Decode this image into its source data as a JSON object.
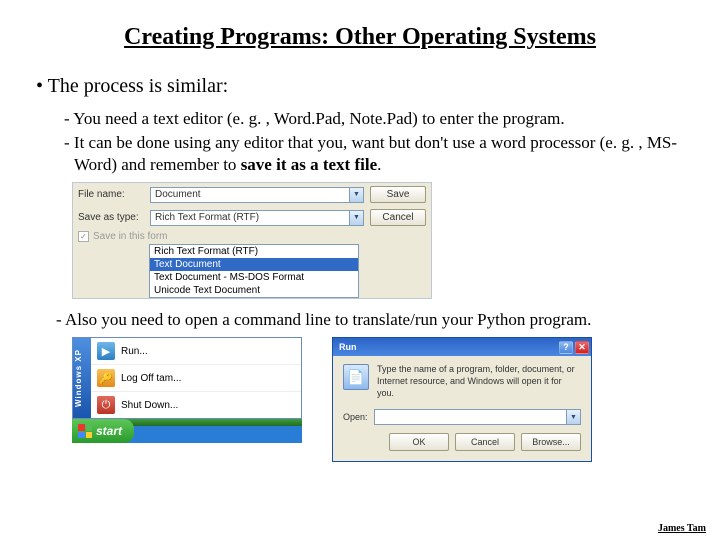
{
  "title": "Creating Programs: Other Operating Systems",
  "main_bullet": "The process is similar:",
  "subs": {
    "a": "You need a text editor (e. g. , Word.Pad, Note.Pad) to enter the program.",
    "b_pre": "It can be done using any editor that you, want but don't use a word processor (e. g. , MS-Word) and remember to ",
    "b_bold": "save it as a text file",
    "b_post": ".",
    "c": "Also you need to open a command line to translate/run your Python program."
  },
  "saveas": {
    "filename_label": "File name:",
    "filename_value": "Document",
    "type_label": "Save as type:",
    "type_value": "Rich Text Format (RTF)",
    "options": {
      "o1": "Rich Text Format (RTF)",
      "o2": "Text Document",
      "o3": "Text Document - MS-DOS Format",
      "o4": "Unicode Text Document"
    },
    "save_btn": "Save",
    "cancel_btn": "Cancel",
    "checkbox": "Save in this form"
  },
  "startmenu": {
    "side": "Windows XP",
    "run": "Run...",
    "logoff": "Log Off tam...",
    "shutdown": "Shut Down...",
    "start": "start"
  },
  "rundlg": {
    "title": "Run",
    "desc": "Type the name of a program, folder, document, or Internet resource, and Windows will open it for you.",
    "open_label": "Open:",
    "ok": "OK",
    "cancel": "Cancel",
    "browse": "Browse..."
  },
  "footer": "James Tam"
}
